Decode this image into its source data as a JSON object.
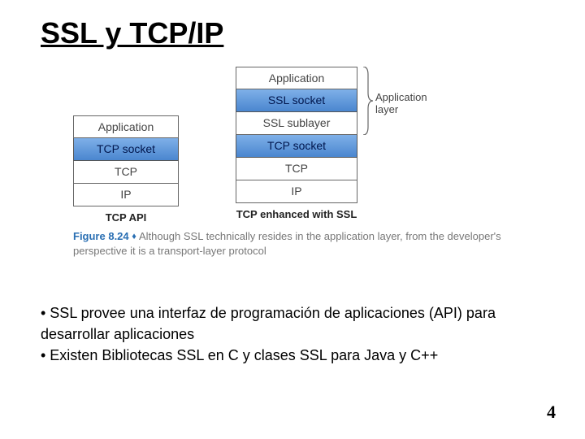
{
  "title": "SSL y TCP/IP",
  "left_stack": {
    "cells": [
      "Application",
      "TCP socket",
      "TCP",
      "IP"
    ],
    "label": "TCP API"
  },
  "right_stack": {
    "cells": [
      "Application",
      "SSL socket",
      "SSL sublayer",
      "TCP socket",
      "TCP",
      "IP"
    ],
    "label": "TCP enhanced with SSL"
  },
  "brace_label": {
    "l1": "Application",
    "l2": "layer"
  },
  "caption": {
    "fig": "Figure 8.24",
    "text": "Although SSL technically resides in the application layer, from the developer's perspective it is a transport-layer protocol"
  },
  "bullets": {
    "b1": "• SSL provee una interfaz de programación de aplicaciones (API) para desarrollar aplicaciones",
    "b2": "• Existen Bibliotecas SSL en C y clases SSL para Java y C++"
  },
  "pagenum": "4"
}
